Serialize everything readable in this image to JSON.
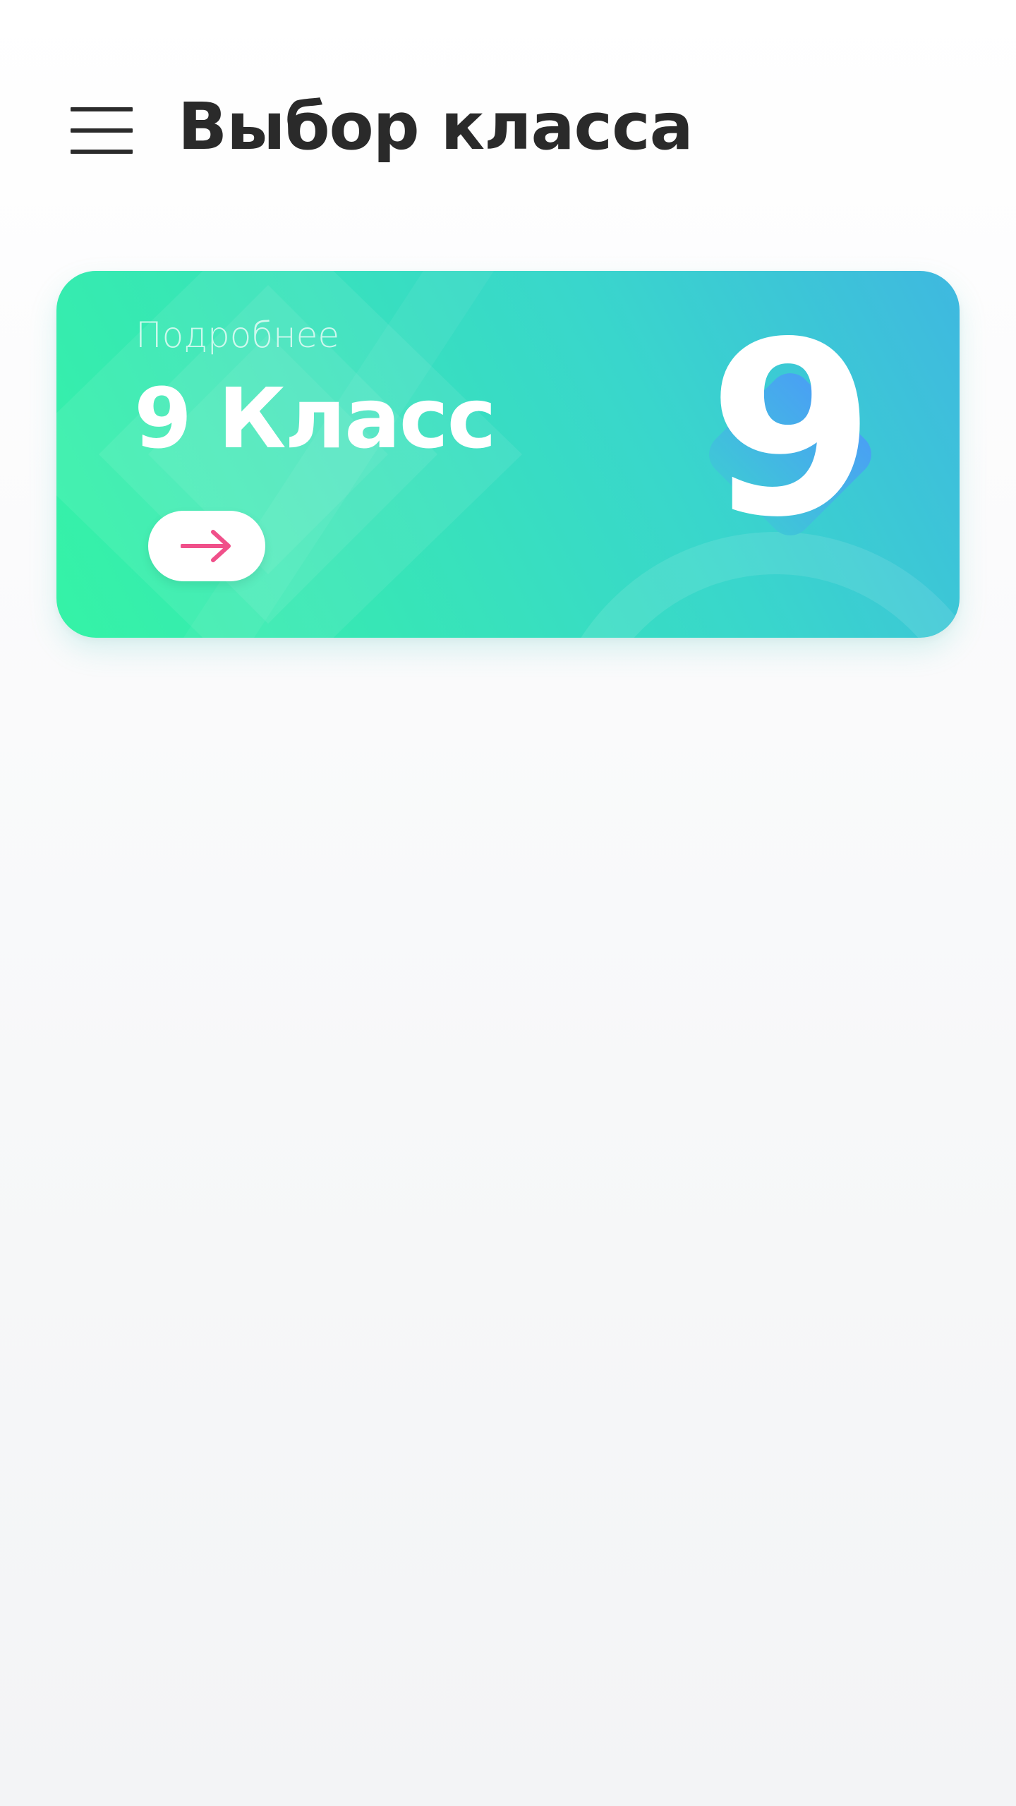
{
  "header": {
    "title": "Выбор класса",
    "menu_icon": "hamburger-menu-icon"
  },
  "grade_card": {
    "subtitle": "Подробнее",
    "title": "9 Класс",
    "big_number": "9",
    "open_icon": "arrow-right-icon",
    "colors": {
      "gradient_start": "#35f3a6",
      "gradient_end": "#3fb8e0",
      "arrow": "#f0508a",
      "badge": "#4aa8ee"
    }
  }
}
